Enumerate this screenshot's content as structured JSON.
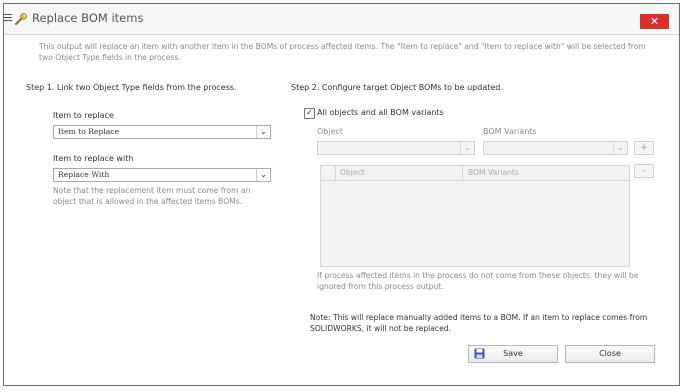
{
  "window": {
    "title": "Replace BOM items",
    "close_label": "✕"
  },
  "description": "This output will replace an item with another item in the BOMs of process affected items. The \"Item to replace\" and \"Item to replace with\" will be selected from two Object Type fields in the process.",
  "step1": {
    "heading": "Step 1. Link two Object Type fields from the process.",
    "item_to_replace_label": "Item to replace",
    "item_to_replace_value": "Item to Replace",
    "item_to_replace_with_label": "Item to replace with",
    "item_to_replace_with_value": "Replace With",
    "note": "Note that the replacement item must come from an object that is allowed in the affected items BOMs."
  },
  "step2": {
    "heading": "Step 2. Configure target Object BOMs to be updated.",
    "all_objects_checked": true,
    "all_objects_label": "All objects and all BOM variants",
    "object_label": "Object",
    "bom_variants_label": "BOM Variants",
    "object_value": "",
    "bom_variants_value": "",
    "add_label": "+",
    "remove_label": "-",
    "grid_columns": [
      "Object",
      "BOM Variants"
    ],
    "info_note": "If process affected items in the process do not come from these objects, they will be ignored from this process output.",
    "warning_note": "Note: This will replace manually added items to a BOM. If an item to replace comes from SOLIDWORKS, it will not be replaced."
  },
  "buttons": {
    "save": "Save",
    "close": "Close"
  },
  "colors": {
    "close_button_bg": "#d9302c",
    "save_icon": "#2a5db0"
  }
}
